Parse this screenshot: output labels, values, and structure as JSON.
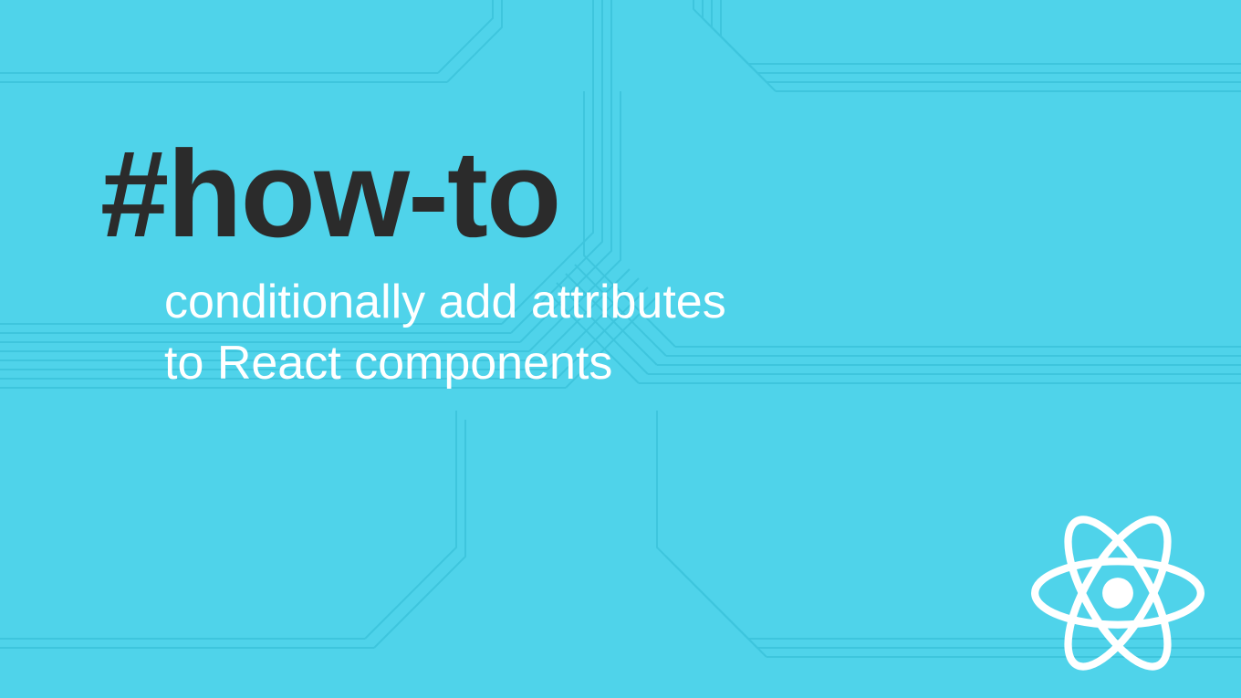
{
  "hashtag": "#how-to",
  "subtitle_line1": "conditionally add attributes",
  "subtitle_line2": "to React components",
  "colors": {
    "background": "#4fd3ea",
    "hashtag": "#2b2b2b",
    "subtitle": "#ffffff",
    "circuit": "#3ec5dd",
    "logo": "#ffffff"
  },
  "logo": "react-icon"
}
